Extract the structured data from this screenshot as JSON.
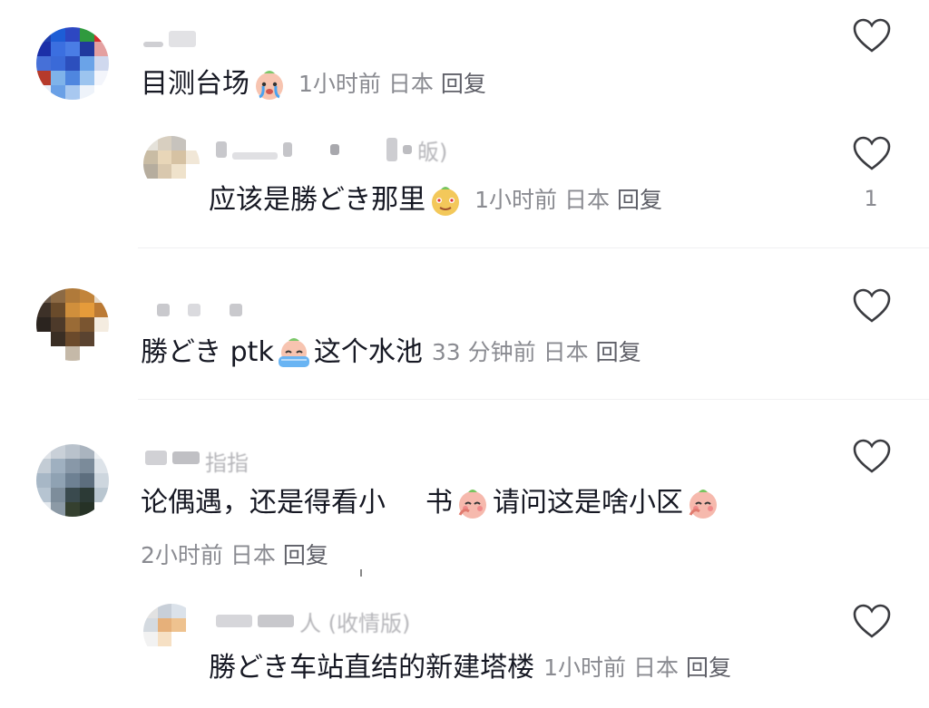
{
  "comments": [
    {
      "avatar_colors": [
        "#1f3fae",
        "#1d5dd6",
        "#2d47c2",
        "#2f9a3e",
        "#d32f2f",
        "#1b2fa8",
        "#3b6fe0",
        "#4a7de5",
        "#21399e",
        "#e4a0a0",
        "#4670d8",
        "#3a6ad8",
        "#2c4fbd",
        "#6aa3e8",
        "#cfd8ee",
        "#b63a2b",
        "#7fb3ea",
        "#4f86df",
        "#9cc4ef",
        "#f3f5fb",
        "#e8eef8",
        "#6aa0e6",
        "#a8c8f0",
        "#eef3fa",
        "#ffffff"
      ],
      "username_blur": [
        "#cfcfd3",
        "#e2e2e5"
      ],
      "text": "目测台场",
      "emoji": "crying-face-emoji",
      "time": "1小时前",
      "location": "日本",
      "reply_label": "回复",
      "like_count": ""
    },
    {
      "avatar_colors": [
        "#e5e2da",
        "#d8cfc0",
        "#c7c3bd",
        "#ffffff",
        "#c9bca4",
        "#e8d6b8",
        "#d6c2a3",
        "#f1e7d7",
        "#b6ad9e",
        "#d9c8ae",
        "#efe2cb",
        "#ffffff",
        "#ffffff",
        "#ffffff",
        "#ffffff",
        "#ffffff"
      ],
      "username_suffix": "皈)",
      "text": "应该是勝どき那里",
      "emoji": "smirk-face-emoji",
      "time": "1小时前",
      "location": "日本",
      "reply_label": "回复",
      "like_count": "1"
    },
    {
      "avatar_colors": [
        "#6b5a4a",
        "#8c6a45",
        "#b07a3a",
        "#c2843a",
        "#e7d9c6",
        "#3d3128",
        "#6a4b2b",
        "#d08f3c",
        "#e59b3a",
        "#bb7a34",
        "#2b241f",
        "#4d3a2a",
        "#9a6b36",
        "#7a5530",
        "#f4ece0",
        "#ffffff",
        "#3a2e24",
        "#6b4a2b",
        "#5a4330",
        "#ffffff",
        "#ffffff",
        "#ffffff",
        "#c5b9a8",
        "#ffffff",
        "#ffffff"
      ],
      "username_blur": [
        "#c9c9cd",
        "#c9c9cd",
        "#c9c9cd"
      ],
      "text_a": "勝どき ptk",
      "text_b": "这个水池",
      "emoji": "crying-face-emoji",
      "time": "33 分钟前",
      "location": "日本",
      "reply_label": "回复",
      "like_count": ""
    },
    {
      "avatar_colors": [
        "#dfe3e8",
        "#c9d0d8",
        "#b9c2cc",
        "#aab4bf",
        "#eef1f4",
        "#c3ccd5",
        "#9fb0c0",
        "#8898a8",
        "#7b8b9a",
        "#dde3e9",
        "#a7b7c6",
        "#8fa2b3",
        "#6e8193",
        "#5d6e7e",
        "#cdd6de",
        "#b6c4d1",
        "#7d8d9b",
        "#3a4a4e",
        "#2c3a36",
        "#b9c6d0",
        "#e4e9ee",
        "#8c9aa6",
        "#35402f",
        "#263226",
        "#ffffff"
      ],
      "username_blur": [
        "#d1d1d5",
        "#c0c0c4"
      ],
      "username_suffix": "指指",
      "text_a": "论偶遇，还是得看小",
      "text_b": "书",
      "emoji_a": "blushing-peach-emoji",
      "text_c": "请问这是啥小区",
      "emoji_b": "blushing-peach-emoji",
      "time": "2小时前",
      "location": "日本",
      "reply_label": "回复",
      "like_count": ""
    },
    {
      "avatar_colors": [
        "#e2e2e2",
        "#c8cfd8",
        "#dbe2ea",
        "#ffffff",
        "#d4dae0",
        "#e6b07a",
        "#eec28f",
        "#ffffff",
        "#f2f2f2",
        "#f6e0c4",
        "#ffffff",
        "#ffffff",
        "#ffffff",
        "#ffffff",
        "#ffffff",
        "#ffffff"
      ],
      "username_suffix": "人  (收情版)",
      "text": "勝どき车站直结的新建塔楼",
      "time": "1小时前",
      "location": "日本",
      "reply_label": "回复",
      "like_count": ""
    }
  ]
}
